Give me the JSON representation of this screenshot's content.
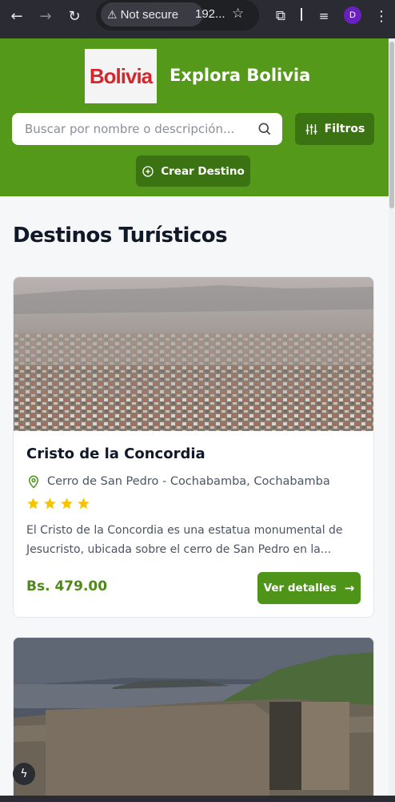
{
  "browser": {
    "security_label": "Not secure",
    "url": "192...",
    "profile_initial": "D"
  },
  "header": {
    "logo_text": "Bolivia",
    "title": "Explora Bolivia",
    "search_placeholder": "Buscar por nombre o descripción...",
    "filters_label": "Filtros",
    "create_label": "Crear Destino"
  },
  "main": {
    "title": "Destinos Turísticos",
    "destinations": [
      {
        "name": "Cristo de la Concordia",
        "location": "Cerro de San Pedro - Cochabamba, Cochabamba",
        "rating": 4,
        "description": "El Cristo de la Concordia es una estatua monumental de Jesucristo, ubicada sobre el cerro de San Pedro en la...",
        "price": "Bs. 479.00",
        "details_label": "Ver detalles"
      }
    ]
  },
  "colors": {
    "header_bg": "#54991a",
    "button_dark": "#3b7212",
    "accent": "#4d9419",
    "star": "#f5c400"
  }
}
